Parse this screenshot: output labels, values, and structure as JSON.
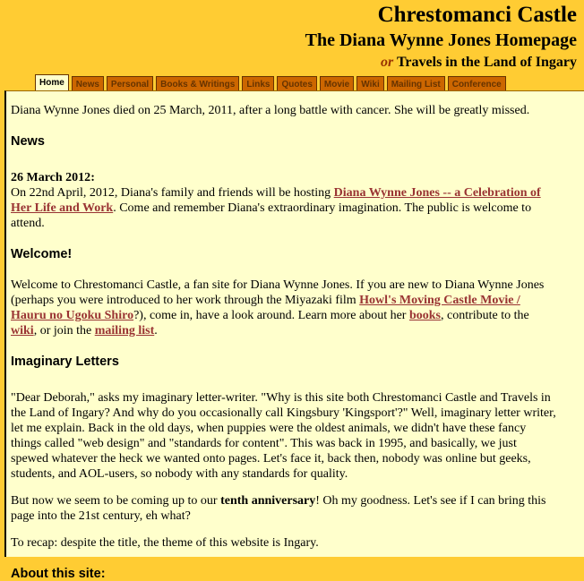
{
  "header": {
    "title": "Chrestomanci Castle",
    "subtitle": "The Diana Wynne Jones Homepage",
    "or": "or",
    "tagline": "Travels in the Land of Ingary"
  },
  "tabs": [
    {
      "label": "Home",
      "active": true
    },
    {
      "label": "News"
    },
    {
      "label": "Personal"
    },
    {
      "label": "Books & Writings"
    },
    {
      "label": "Links"
    },
    {
      "label": "Quotes"
    },
    {
      "label": "Movie"
    },
    {
      "label": "Wiki"
    },
    {
      "label": "Mailing List"
    },
    {
      "label": "Conference"
    }
  ],
  "memorial": "Diana Wynne Jones died on 25 March, 2011, after a long battle with cancer. She will be greatly missed.",
  "news": {
    "heading": "News",
    "date": "26 March 2012",
    "text1": "On 22nd April, 2012, Diana's family and friends will be hosting ",
    "link": "Diana Wynne Jones -- a Celebration of Her Life and Work",
    "text2": ". Come and remember Diana's extraordinary imagination. The public is welcome to attend."
  },
  "welcome": {
    "heading": "Welcome!",
    "text1": "Welcome to Chrestomanci Castle, a fan site for Diana Wynne Jones. If you are new to Diana Wynne Jones (perhaps you were introduced to her work through the Miyazaki film ",
    "movie_link": "Howl's Moving Castle Movie / Hauru no Ugoku Shiro",
    "text2": "?), come in, have a look around. Learn more about her ",
    "books_link": "books",
    "text3": ", contribute to the ",
    "wiki_link": "wiki",
    "text4": ", or join the ",
    "mailing_link": "mailing list",
    "text5": "."
  },
  "letters": {
    "heading": "Imaginary Letters",
    "p1": "\"Dear Deborah,\" asks my imaginary letter-writer. \"Why is this site both Chrestomanci Castle and Travels in the Land of Ingary? And why do you occasionally call Kingsbury 'Kingsport'?\" Well, imaginary letter writer, let me explain. Back in the old days, when puppies were the oldest animals, we didn't have these fancy things called \"web design\" and \"standards for content\". This was back in 1995, and basically, we just spewed whatever the heck we wanted onto pages. Let's face it, back then, nobody was online but geeks, students, and AOL-users, so nobody with any standards for quality.",
    "p2a": "But now we seem to be coming up to our ",
    "p2b": "tenth anniversary",
    "p2c": "! Oh my goodness. Let's see if I can bring this page into the 21st century, eh what?",
    "p3": "To recap: despite the title, the theme of this website is Ingary."
  },
  "about": {
    "heading": "About this site:"
  }
}
